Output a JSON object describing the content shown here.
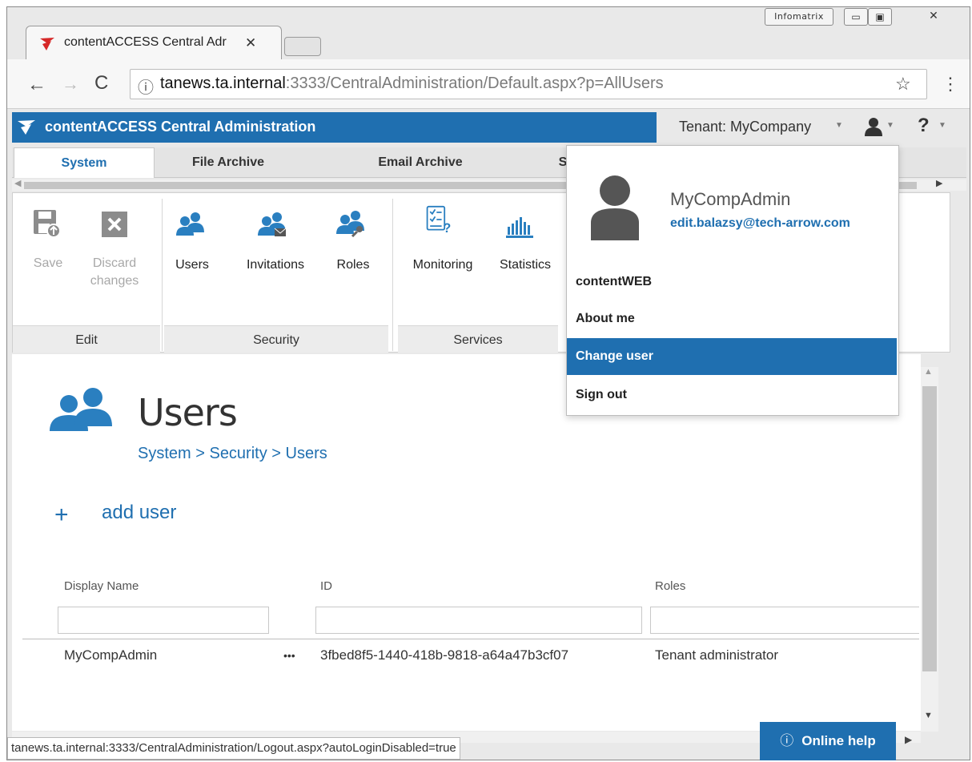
{
  "window": {
    "infomatrix_label": "Infomatrix",
    "minimize_glyph": "▭",
    "maximize_glyph": "▣",
    "close_glyph": "✕"
  },
  "browser": {
    "tab_title": "contentACCESS Central Adr",
    "tab_close": "✕",
    "url_host": "tanews.ta.internal",
    "url_rest": ":3333/CentralAdministration/Default.aspx?p=AllUsers",
    "back": "←",
    "forward": "→",
    "reload": "C",
    "info": "ⓘ",
    "star": "☆",
    "menu": "⋮"
  },
  "app": {
    "title": "contentACCESS Central Administration",
    "tenant": "Tenant: MyCompany",
    "caret": "▼",
    "help": "?",
    "accent_color": "#1f6fb0"
  },
  "ribbon": {
    "tabs": [
      "System",
      "File Archive",
      "Email Archive",
      "S"
    ],
    "buttons": {
      "save": "Save",
      "discard_line1": "Discard",
      "discard_line2": "changes",
      "users": "Users",
      "invitations": "Invitations",
      "roles": "Roles",
      "monitoring": "Monitoring",
      "statistics": "Statistics"
    },
    "groups": [
      "Edit",
      "Security",
      "Services"
    ]
  },
  "page": {
    "title": "Users",
    "breadcrumb": "System > Security > Users",
    "add_plus": "+",
    "add_label": "add user",
    "columns": [
      "Display Name",
      "ID",
      "Roles"
    ],
    "rows": [
      {
        "display_name": "MyCompAdmin",
        "more": "•••",
        "id": "3fbed8f5-1440-418b-9818-a64a47b3cf07",
        "roles": "Tenant administrator"
      }
    ]
  },
  "user_menu": {
    "name": "MyCompAdmin",
    "email": "edit.balazsy@tech-arrow.com",
    "items": [
      "contentWEB",
      "About me",
      "Change user",
      "Sign out"
    ],
    "active_item": "Change user"
  },
  "status": {
    "url": "tanews.ta.internal:3333/CentralAdministration/Logout.aspx?autoLoginDisabled=true"
  },
  "help_button": {
    "icon": "ⓘ",
    "label": "Online help",
    "arrow": "▶"
  }
}
